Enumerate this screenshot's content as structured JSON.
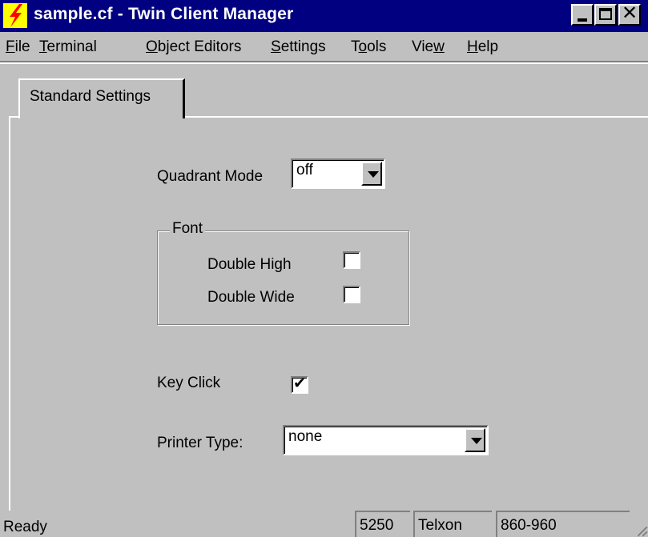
{
  "window": {
    "title": "sample.cf - Twin Client Manager",
    "app_icon": "lightning-bolt-icon",
    "controls": {
      "minimize": "minimize-icon",
      "maximize": "maximize-icon",
      "close": "close-icon"
    }
  },
  "menu": {
    "items": [
      {
        "label": "File",
        "mnemonic": "F"
      },
      {
        "label": "Terminal",
        "mnemonic": "T"
      },
      {
        "label": "Object Editors",
        "mnemonic": "O"
      },
      {
        "label": "Settings",
        "mnemonic": "S"
      },
      {
        "label": "Tools",
        "mnemonic": "o"
      },
      {
        "label": "View",
        "mnemonic": "w"
      },
      {
        "label": "Help",
        "mnemonic": "H"
      }
    ]
  },
  "tab": {
    "label": "Standard Settings"
  },
  "form": {
    "quadrant_mode": {
      "label": "Quadrant Mode",
      "value": "off"
    },
    "font_group": {
      "legend": "Font",
      "double_high": {
        "label": "Double High",
        "checked": false
      },
      "double_wide": {
        "label": "Double Wide",
        "checked": false
      }
    },
    "key_click": {
      "label": "Key Click",
      "checked": true
    },
    "printer_type": {
      "label": "Printer Type:",
      "value": "none"
    }
  },
  "status": {
    "message": "Ready",
    "panes": [
      "5250",
      "Telxon",
      "860-960"
    ]
  },
  "colors": {
    "titlebar": "#000080",
    "face": "#c0c0c0",
    "icon_bg": "#ffff00",
    "icon_bolt": "#ff0000"
  }
}
